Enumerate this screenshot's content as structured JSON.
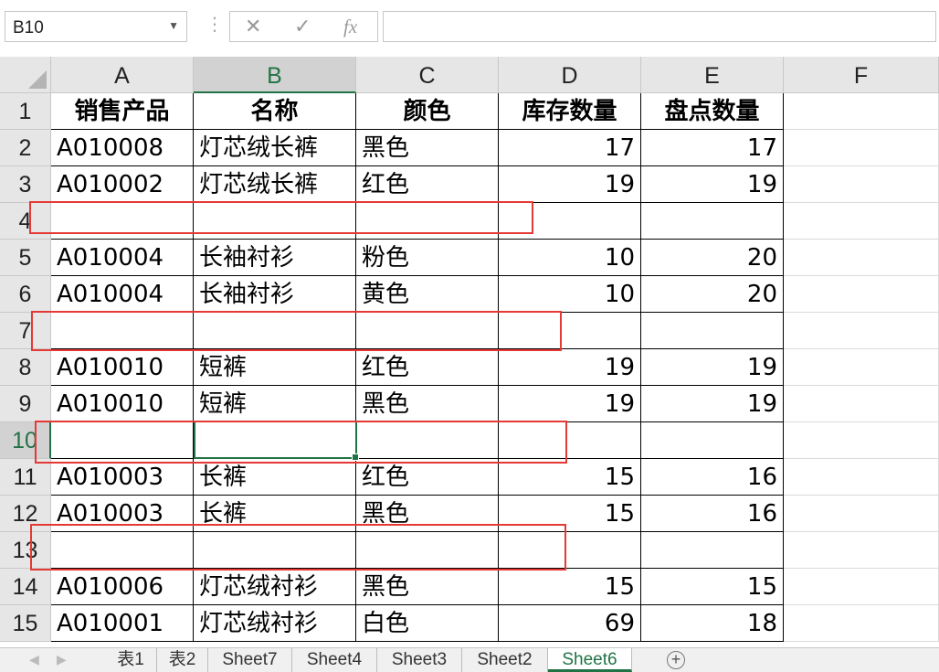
{
  "formula_bar": {
    "name_box": "B10",
    "cancel_glyph": "✕",
    "enter_glyph": "✓",
    "fx_label": "fx",
    "formula": ""
  },
  "columns": [
    "A",
    "B",
    "C",
    "D",
    "E",
    "F"
  ],
  "rows": [
    "1",
    "2",
    "3",
    "4",
    "5",
    "6",
    "7",
    "8",
    "9",
    "10",
    "11",
    "12",
    "13",
    "14",
    "15"
  ],
  "table": {
    "headers": [
      "销售产品",
      "名称",
      "颜色",
      "库存数量",
      "盘点数量"
    ],
    "rows": [
      [
        "A010008",
        "灯芯绒长裤",
        "黑色",
        "17",
        "17"
      ],
      [
        "A010002",
        "灯芯绒长裤",
        "红色",
        "19",
        "19"
      ],
      [
        "",
        "",
        "",
        "",
        ""
      ],
      [
        "A010004",
        "长袖衬衫",
        "粉色",
        "10",
        "20"
      ],
      [
        "A010004",
        "长袖衬衫",
        "黄色",
        "10",
        "20"
      ],
      [
        "",
        "",
        "",
        "",
        ""
      ],
      [
        "A010010",
        "短裤",
        "红色",
        "19",
        "19"
      ],
      [
        "A010010",
        "短裤",
        "黑色",
        "19",
        "19"
      ],
      [
        "",
        "",
        "",
        "",
        ""
      ],
      [
        "A010003",
        "长裤",
        "红色",
        "15",
        "16"
      ],
      [
        "A010003",
        "长裤",
        "黑色",
        "15",
        "16"
      ],
      [
        "",
        "",
        "",
        "",
        ""
      ],
      [
        "A010006",
        "灯芯绒衬衫",
        "黑色",
        "15",
        "15"
      ],
      [
        "A010001",
        "灯芯绒衬衫",
        "白色",
        "69",
        "18"
      ]
    ]
  },
  "selection": {
    "cell": "B10"
  },
  "sheet_tabs": [
    "表1",
    "表2",
    "Sheet7",
    "Sheet4",
    "Sheet3",
    "Sheet2",
    "Sheet6"
  ],
  "active_sheet": "Sheet6",
  "colors": {
    "accent": "#217346",
    "highlight": "#e53935"
  }
}
